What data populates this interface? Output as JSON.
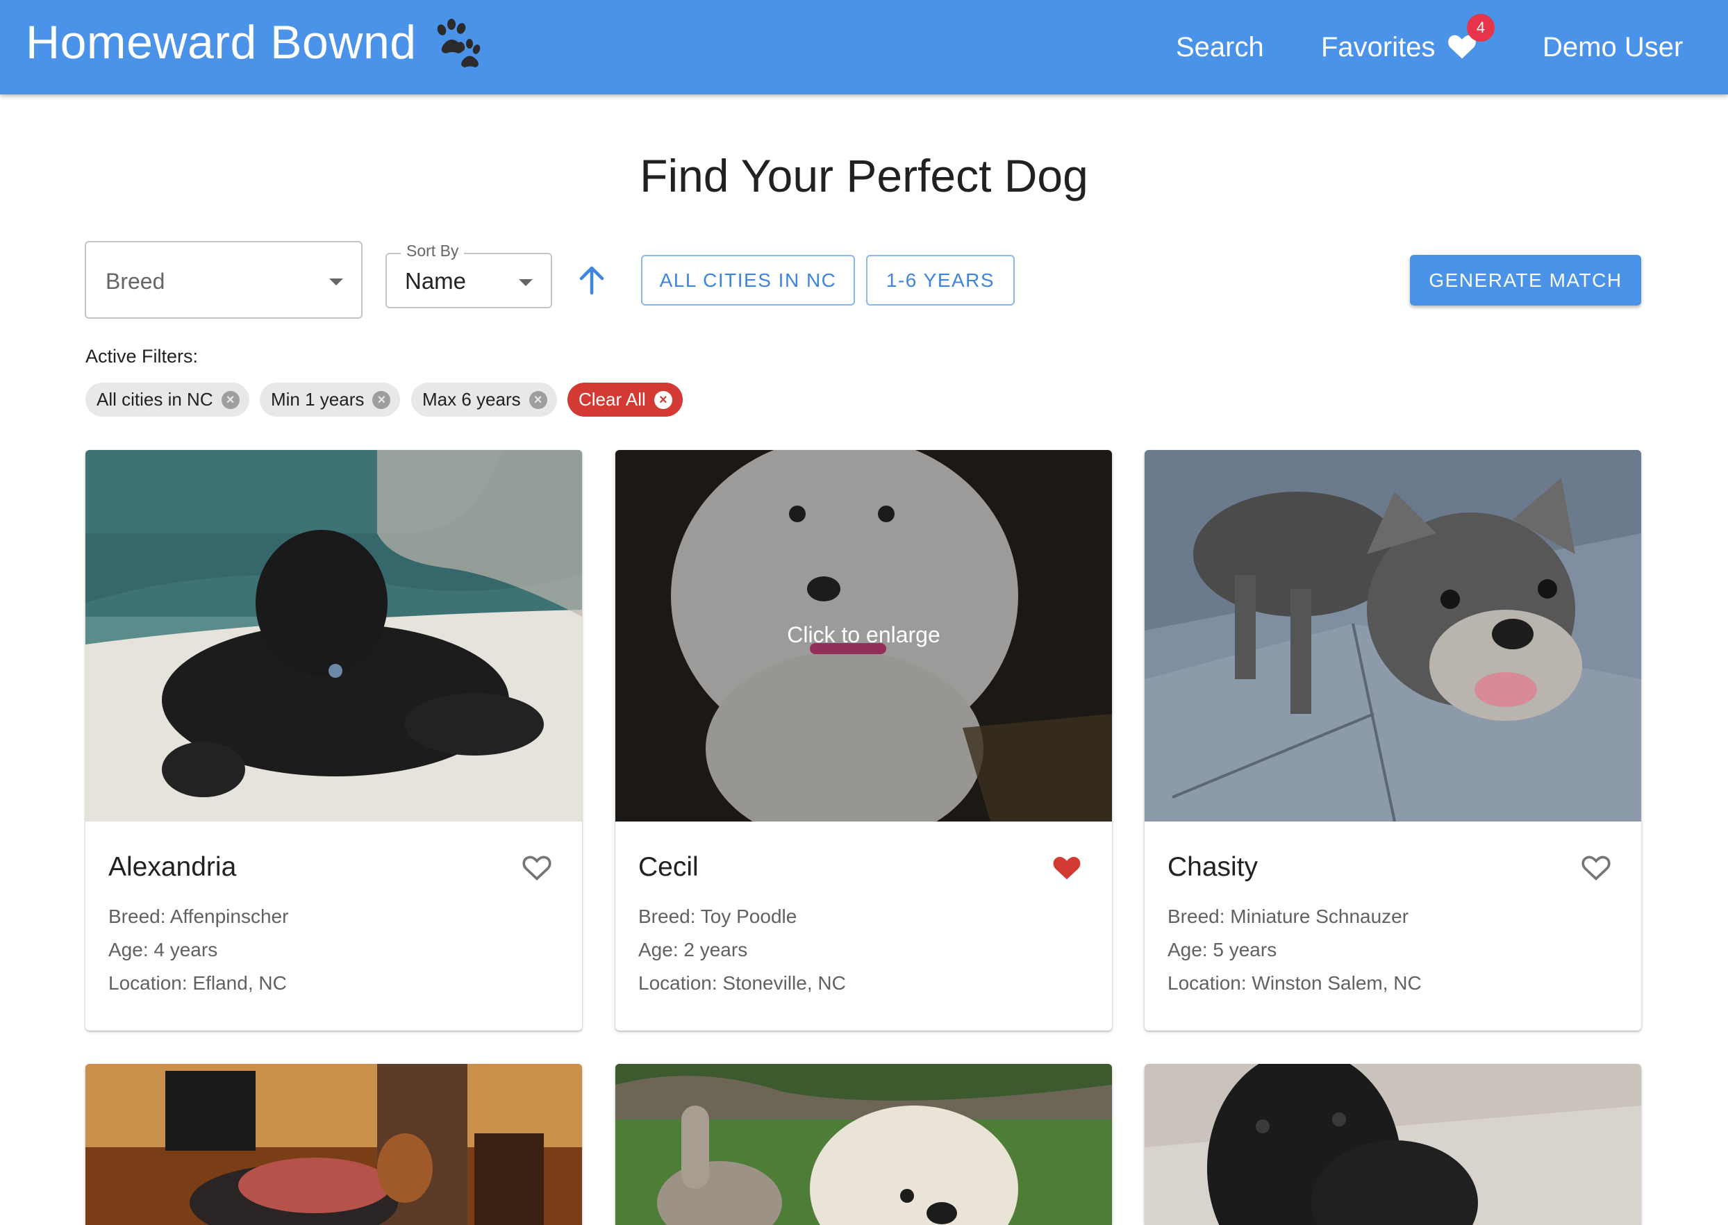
{
  "header": {
    "title": "Homeward Bownd",
    "logo_icon": "paw-icon",
    "nav": {
      "search": "Search",
      "favorites": "Favorites",
      "favorites_count": "4",
      "user": "Demo User"
    }
  },
  "main": {
    "title": "Find Your Perfect Dog",
    "breed_select": {
      "placeholder": "Breed"
    },
    "sort": {
      "label": "Sort By",
      "value": "Name",
      "direction_icon": "arrow-up-icon"
    },
    "quick_filters": [
      "ALL CITIES IN NC",
      "1-6 YEARS"
    ],
    "generate_button": "GENERATE MATCH",
    "active_filters_label": "Active Filters:",
    "active_filters": [
      "All cities in NC",
      "Min 1 years",
      "Max 6 years"
    ],
    "clear_all": "Clear All",
    "image_overlay": "Click to enlarge"
  },
  "dogs": [
    {
      "name": "Alexandria",
      "breed": "Breed: Affenpinscher",
      "age": "Age: 4 years",
      "location": "Location: Efland, NC",
      "favorite": false
    },
    {
      "name": "Cecil",
      "breed": "Breed: Toy Poodle",
      "age": "Age: 2 years",
      "location": "Location: Stoneville, NC",
      "favorite": true
    },
    {
      "name": "Chasity",
      "breed": "Breed: Miniature Schnauzer",
      "age": "Age: 5 years",
      "location": "Location: Winston Salem, NC",
      "favorite": false
    }
  ],
  "colors": {
    "primary": "#4a93e8",
    "favorite": "#d23a33",
    "badge": "#e8344a"
  }
}
